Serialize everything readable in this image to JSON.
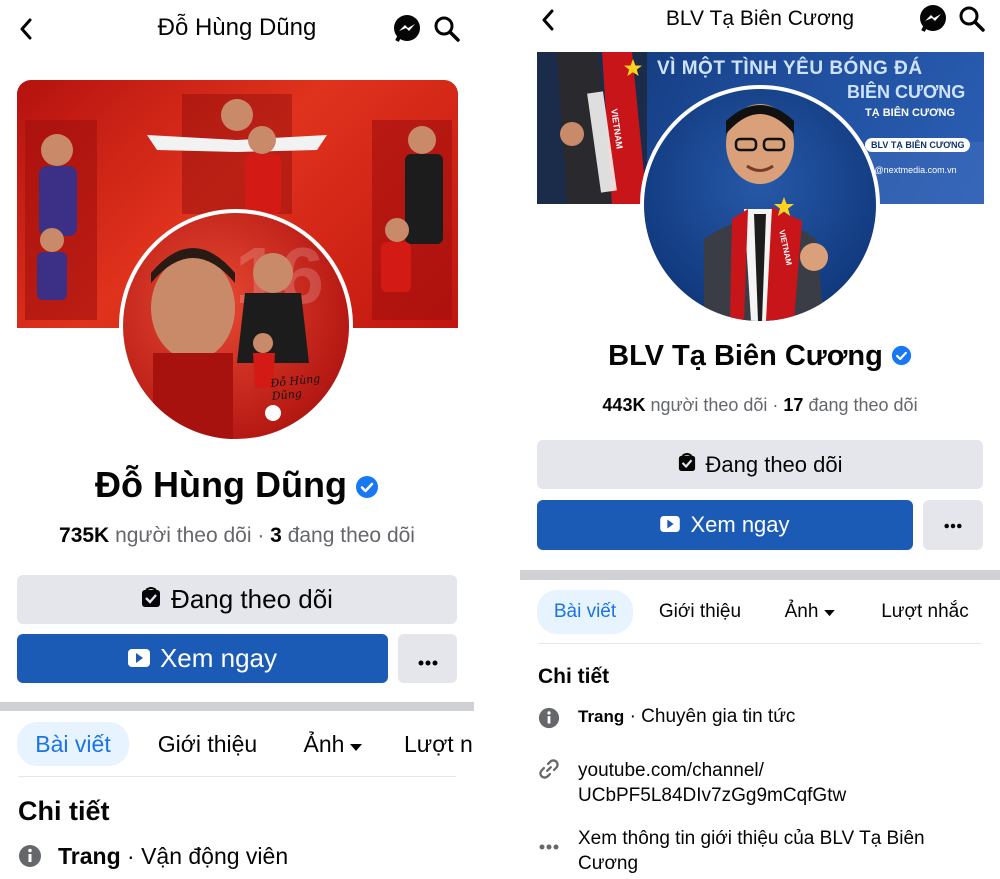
{
  "left": {
    "header": {
      "title": "Đỗ Hùng Dũng"
    },
    "cover": {
      "signature": "Đỗ Hùng Dũng",
      "jersey_number": "16"
    },
    "profile": {
      "name": "Đỗ Hùng Dũng",
      "followers": "735K",
      "followers_label": "người theo dõi",
      "following": "3",
      "following_label": "đang theo dõi"
    },
    "buttons": {
      "following": "Đang theo dõi",
      "watch": "Xem ngay"
    },
    "tabs": {
      "posts": "Bài viết",
      "about": "Giới thiệu",
      "photos": "Ảnh",
      "reels": "Lượt n"
    },
    "details": {
      "title": "Chi tiết",
      "kind": "Trang",
      "category": " · Vận động viên"
    }
  },
  "right": {
    "header": {
      "title": "BLV Tạ Biên Cương"
    },
    "cover": {
      "line1": "VÌ MỘT TÌNH YÊU BÓNG ĐÁ",
      "line2": "BIÊN CƯƠNG",
      "line3": "TẠ BIÊN CƯƠNG",
      "line4": "BLV TẠ BIÊN CƯƠNG",
      "line5": "qc@nextmedia.com.vn",
      "scarf": "VIETNAM",
      "scarf_left": "VIETNAM"
    },
    "profile": {
      "name": "BLV Tạ Biên Cương",
      "followers": "443K",
      "followers_label": "người theo dõi",
      "following": "17",
      "following_label": "đang theo dõi"
    },
    "buttons": {
      "following": "Đang theo dõi",
      "watch": "Xem ngay"
    },
    "tabs": {
      "posts": "Bài viết",
      "about": "Giới thiệu",
      "photos": "Ảnh",
      "reels": "Lượt nhắc"
    },
    "details": {
      "title": "Chi tiết",
      "kind": "Trang",
      "category": " · Chuyên gia tin tức",
      "link_line1": "youtube.com/channel/",
      "link_line2": "UCbPF5L84DIv7zGg9mCqfGtw",
      "more_line1": "Xem thông tin giới thiệu của BLV Tạ Biên",
      "more_line2": "Cương"
    }
  },
  "colors": {
    "accent": "#1b74e4",
    "primary_button": "#1b5bb6",
    "verified": "#1877f2",
    "gray_button": "#e4e6eb",
    "cover_red": "#d8261c"
  }
}
